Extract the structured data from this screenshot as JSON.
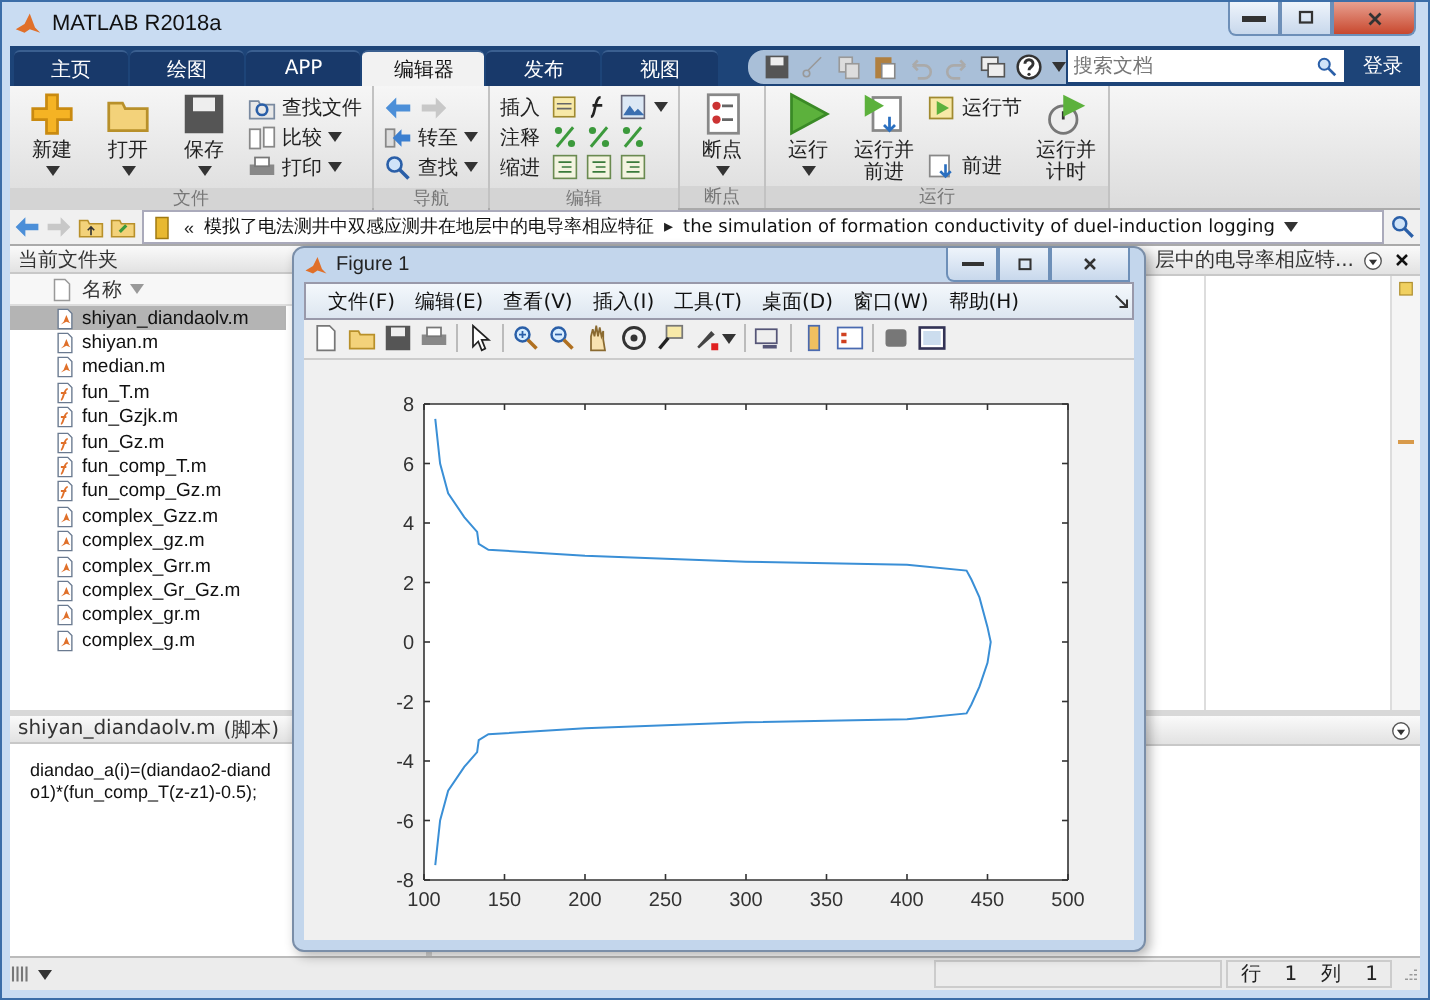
{
  "window": {
    "title": "MATLAB R2018a"
  },
  "tabs": [
    {
      "label": "主页",
      "selected": false
    },
    {
      "label": "绘图",
      "selected": false
    },
    {
      "label": "APP",
      "selected": false
    },
    {
      "label": "编辑器",
      "selected": true
    },
    {
      "label": "发布",
      "selected": false
    },
    {
      "label": "视图",
      "selected": false
    }
  ],
  "search": {
    "placeholder": "搜索文档"
  },
  "sign_in": "登录",
  "ribbon": {
    "groups": [
      {
        "label": "文件",
        "columns": [
          {
            "kind": "large",
            "label": "新建",
            "dropdown": true
          },
          {
            "kind": "large",
            "label": "打开",
            "dropdown": true
          },
          {
            "kind": "large",
            "label": "保存",
            "dropdown": true
          },
          {
            "kind": "stack",
            "items": [
              {
                "kind": "button",
                "label": "查找文件",
                "dropdown": false
              },
              {
                "kind": "button",
                "label": "比较",
                "dropdown": true
              },
              {
                "kind": "button",
                "label": "打印",
                "dropdown": true
              }
            ]
          }
        ]
      },
      {
        "label": "导航",
        "columns": [
          {
            "kind": "stack",
            "items": [
              {
                "kind": "arrows"
              },
              {
                "kind": "button",
                "label": "转至",
                "dropdown": true
              },
              {
                "kind": "button",
                "label": "查找",
                "dropdown": true
              }
            ]
          }
        ]
      },
      {
        "label": "编辑",
        "columns": [
          {
            "kind": "stack",
            "items": [
              {
                "kind": "icon-row",
                "label": "插入",
                "dropdown": true
              },
              {
                "kind": "icon-row",
                "label": "注释",
                "dropdown": false
              },
              {
                "kind": "icon-row",
                "label": "缩进",
                "dropdown": false
              }
            ]
          }
        ]
      },
      {
        "label": "断点",
        "columns": [
          {
            "kind": "large",
            "label": "断点",
            "dropdown": true
          }
        ]
      },
      {
        "label": "运行",
        "columns": [
          {
            "kind": "large",
            "label": "运行",
            "dropdown": true
          },
          {
            "kind": "large",
            "label": "运行并前进",
            "dropdown": false
          },
          {
            "kind": "stack",
            "items": [
              {
                "kind": "button",
                "label": "运行节",
                "dropdown": false
              },
              {
                "kind": "button",
                "label": "前进",
                "dropdown": false
              }
            ]
          },
          {
            "kind": "large",
            "label": "运行并计时",
            "dropdown": false
          }
        ]
      }
    ]
  },
  "address_bar": {
    "overflow_mark": "«",
    "separator": "▸",
    "path": [
      "模拟了电法测井中双感应测井在地层中的电导率相应特征",
      "the simulation of formation conductivity of duel-induction logging"
    ]
  },
  "current_folder": {
    "title": "当前文件夹",
    "column": "名称",
    "files": [
      {
        "name": "shiyan_diandaolv.m",
        "kind": "script",
        "selected": true
      },
      {
        "name": "shiyan.m",
        "kind": "script",
        "selected": false
      },
      {
        "name": "median.m",
        "kind": "script",
        "selected": false
      },
      {
        "name": "fun_T.m",
        "kind": "function",
        "selected": false
      },
      {
        "name": "fun_Gzjk.m",
        "kind": "function",
        "selected": false
      },
      {
        "name": "fun_Gz.m",
        "kind": "function",
        "selected": false
      },
      {
        "name": "fun_comp_T.m",
        "kind": "function",
        "selected": false
      },
      {
        "name": "fun_comp_Gz.m",
        "kind": "function",
        "selected": false
      },
      {
        "name": "complex_Gzz.m",
        "kind": "script",
        "selected": false
      },
      {
        "name": "complex_gz.m",
        "kind": "script",
        "selected": false
      },
      {
        "name": "complex_Grr.m",
        "kind": "script",
        "selected": false
      },
      {
        "name": "complex_Gr_Gz.m",
        "kind": "script",
        "selected": false
      },
      {
        "name": "complex_gr.m",
        "kind": "script",
        "selected": false
      },
      {
        "name": "complex_g.m",
        "kind": "script",
        "selected": false
      }
    ]
  },
  "details": {
    "file": "shiyan_diandaolv.m",
    "type": "(脚本)",
    "code": [
      "diandao_a(i)=(diandao2-diand",
      "o1)*(fun_comp_T(z-z1)-0.5);"
    ]
  },
  "editor": {
    "tab_title": "层中的电导率相应特..."
  },
  "figure": {
    "title": "Figure 1",
    "menu": [
      "文件(F)",
      "编辑(E)",
      "查看(V)",
      "插入(I)",
      "工具(T)",
      "桌面(D)",
      "窗口(W)",
      "帮助(H)"
    ],
    "chart_data": {
      "type": "line",
      "x": [
        107,
        110,
        115,
        125,
        133,
        134,
        140,
        200,
        300,
        400,
        437,
        440,
        445,
        450,
        452,
        450,
        445,
        440,
        437,
        400,
        300,
        200,
        140,
        134,
        133,
        125,
        115,
        110,
        107
      ],
      "series": [
        {
          "color": "#3a8fd6",
          "values": [
            7.5,
            6,
            5,
            4.2,
            3.7,
            3.3,
            3.1,
            2.9,
            2.7,
            2.6,
            2.4,
            2.1,
            1.5,
            0.5,
            0,
            -0.7,
            -1.5,
            -2.1,
            -2.4,
            -2.6,
            -2.7,
            -2.9,
            -3.1,
            -3.3,
            -3.7,
            -4.2,
            -5,
            -6,
            -7.5
          ]
        }
      ],
      "xlim": [
        100,
        500
      ],
      "ylim": [
        -8,
        8
      ],
      "xticks": [
        100,
        150,
        200,
        250,
        300,
        350,
        400,
        450,
        500
      ],
      "yticks": [
        -8,
        -6,
        -4,
        -2,
        0,
        2,
        4,
        6,
        8
      ]
    }
  },
  "status_bar": {
    "line_label": "行",
    "line": "1",
    "column_label": "列",
    "column": "1"
  }
}
